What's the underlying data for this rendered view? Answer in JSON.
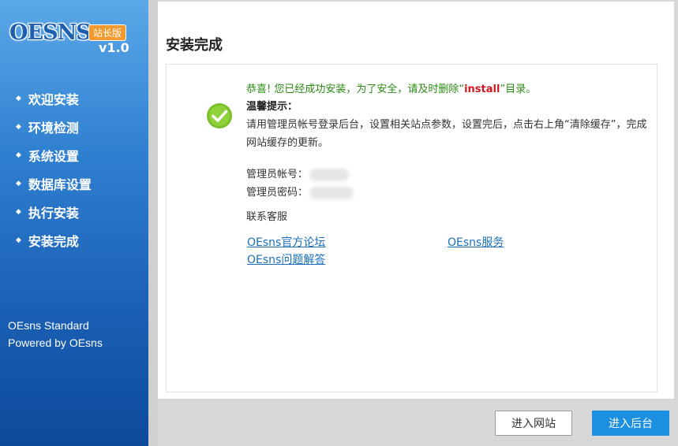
{
  "sidebar": {
    "logo_text": "OESNS",
    "logo_badge": "站长版",
    "version": "v1.0",
    "nav": [
      "欢迎安装",
      "环境检测",
      "系统设置",
      "数据库设置",
      "执行安装",
      "安装完成"
    ],
    "footer_line1": "OEsns Standard",
    "footer_line2": "Powered by OEsns"
  },
  "main": {
    "title": "安装完成",
    "success_prefix": "恭喜! 您已经成功安装，为了安全，请及时删除“",
    "success_keyword": "install",
    "success_suffix": "”目录。",
    "tip_title": "温馨提示：",
    "tip_text": "请用管理员帐号登录后台，设置相关站点参数，设置完后，点击右上角“清除缓存”，完成网站缓存的更新。",
    "admin_account_label": "管理员帐号：",
    "admin_password_label": "管理员密码：",
    "contact_label": "联系客服",
    "links": [
      "OEsns官方论坛",
      "OEsns服务",
      "OEsns问题解答"
    ]
  },
  "buttons": {
    "enter_site": "进入网站",
    "enter_admin": "进入后台"
  },
  "colors": {
    "success_green": "#2a8a12",
    "keyword_red": "#d2161e",
    "link_blue": "#1a6fb8",
    "primary_button": "#1d8fe0"
  }
}
